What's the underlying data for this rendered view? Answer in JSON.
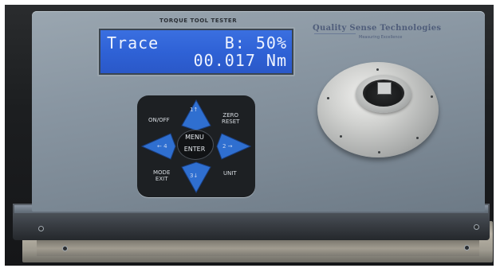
{
  "device": {
    "header_title": "TORQUE TOOL TESTER",
    "brand_name": "Quality Sense Technologies",
    "brand_tagline": "Measuring Excellence"
  },
  "display": {
    "mode": "Trace",
    "backlight": "B: 50%",
    "reading": "00.017 Nm"
  },
  "keypad": {
    "on_off": "ON/OFF",
    "zero_reset": [
      "ZERO",
      "RESET"
    ],
    "mode_exit": [
      "MODE",
      "EXIT"
    ],
    "unit": "UNIT",
    "menu_enter": [
      "MENU",
      "ENTER"
    ],
    "up": "1↑",
    "down": "3↓",
    "left": "← 4",
    "right": "2 →"
  },
  "colors": {
    "lcd_background": "#2f62d6",
    "lcd_text": "#eef3ff",
    "keypad_arrow_blue": "#2f6fd0",
    "case_gray": "#8996a2"
  }
}
